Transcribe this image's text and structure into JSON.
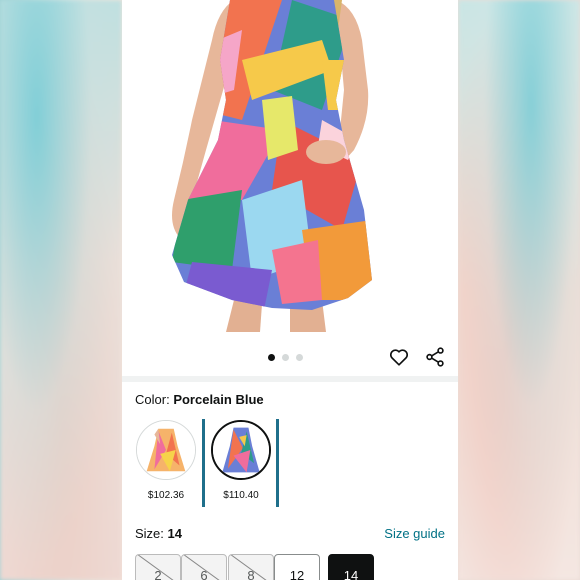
{
  "product": {
    "color_label": "Color:",
    "color_value": "Porcelain Blue",
    "size_label": "Size:",
    "size_value": "14",
    "size_guide": "Size guide"
  },
  "carousel": {
    "total": 3,
    "active_index": 0
  },
  "swatches": [
    {
      "price": "$102.36",
      "selected": false
    },
    {
      "price": "$110.40",
      "selected": true
    }
  ],
  "sizes": [
    {
      "label": "2",
      "available": false
    },
    {
      "label": "6",
      "available": false
    },
    {
      "label": "8",
      "available": false
    },
    {
      "label": "12",
      "available": true
    },
    {
      "label": "14",
      "available": true,
      "selected": true
    }
  ],
  "icons": {
    "favorite": "heart-icon",
    "share": "share-icon"
  },
  "colors": {
    "link": "#007185",
    "text": "#0f1111",
    "selected_bar": "#1f6f8b"
  }
}
